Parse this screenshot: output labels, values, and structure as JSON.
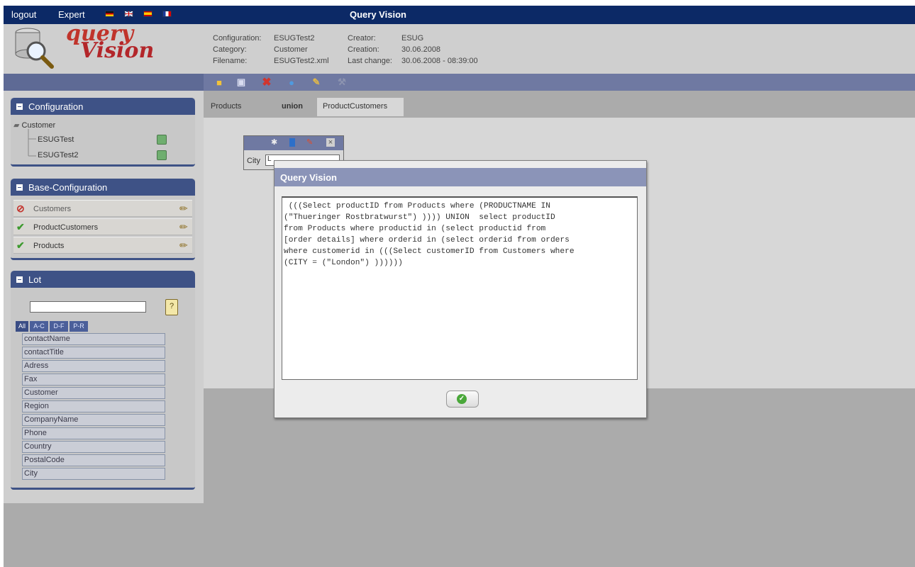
{
  "topbar": {
    "logout": "logout",
    "expert": "Expert",
    "title": "Query Vision",
    "flags": [
      "de-flag-icon",
      "uk-flag-icon",
      "es-flag-icon",
      "fr-flag-icon"
    ]
  },
  "logo": {
    "line1": "query",
    "line2": "Vision"
  },
  "info": {
    "configuration_label": "Configuration:",
    "configuration_value": "ESUGTest2",
    "category_label": "Category:",
    "category_value": "Customer",
    "filename_label": "Filename:",
    "filename_value": "ESUGTest2.xml",
    "creator_label": "Creator:",
    "creator_value": "ESUG",
    "creation_label": "Creation:",
    "creation_value": "30.06.2008",
    "lastchange_label": "Last change:",
    "lastchange_value": "30.06.2008 - 08:39:00"
  },
  "toolbar_icons": [
    "open-icon",
    "save-icon",
    "delete-icon",
    "help-icon",
    "wand-icon",
    "tools-icon"
  ],
  "configuration_panel": {
    "title": "Configuration",
    "root": "Customer",
    "items": [
      "ESUGTest",
      "ESUGTest2"
    ]
  },
  "base_panel": {
    "title": "Base-Configuration",
    "items": [
      {
        "label": "Customers",
        "status": "blocked"
      },
      {
        "label": "ProductCustomers",
        "status": "ok"
      },
      {
        "label": "Products",
        "status": "ok"
      }
    ]
  },
  "lot_panel": {
    "title": "Lot",
    "search_value": "",
    "filters": [
      "All",
      "A-C",
      "D-F",
      "P-R"
    ],
    "fields": [
      "contactName",
      "contactTitle",
      "Adress",
      "Fax",
      "Customer",
      "Region",
      "CompanyName",
      "Phone",
      "Country",
      "PostalCode",
      "City"
    ]
  },
  "tabs": [
    "Products",
    "union",
    "ProductCustomers"
  ],
  "widget": {
    "city_label": "City",
    "city_value": "L"
  },
  "dialog": {
    "title": "Query Vision",
    "query": " (((Select productID from Products where (PRODUCTNAME IN\n(\"Thueringer Rostbratwurst\") )))) UNION  select productID\nfrom Products where productid in (select productid from\n[order details] where orderid in (select orderid from orders\nwhere customerid in (((Select customerID from Customers where\n(CITY = (\"London\") ))))))"
  },
  "colors": {
    "topbar": "#0c2966",
    "panel_header": "#3e5286",
    "strip": "#6f79a2",
    "dialog_header": "#8b94b8"
  }
}
